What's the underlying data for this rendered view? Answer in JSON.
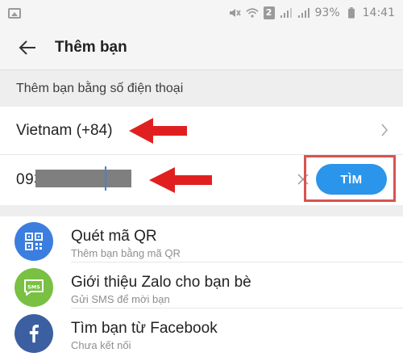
{
  "status_bar": {
    "battery_percent": "93%",
    "time": "14:41",
    "sim_label": "2"
  },
  "header": {
    "title": "Thêm bạn"
  },
  "section": {
    "label": "Thêm bạn bằng số điện thoại"
  },
  "country": {
    "value": "Vietnam (+84)"
  },
  "phone": {
    "value": "093"
  },
  "find_button": {
    "label": "TÌM"
  },
  "menu": {
    "items": [
      {
        "title": "Quét mã QR",
        "subtitle": "Thêm bạn bằng mã QR",
        "icon": "qr-code-icon",
        "color": "#3b7ee0"
      },
      {
        "title": "Giới thiệu Zalo cho bạn bè",
        "subtitle": "Gửi SMS để mời bạn",
        "icon": "sms-icon",
        "color": "#79c043"
      },
      {
        "title": "Tìm bạn từ Facebook",
        "subtitle": "Chưa kết nối",
        "icon": "facebook-icon",
        "color": "#3b5fa0"
      }
    ]
  },
  "colors": {
    "accent": "#2a95ea",
    "annotation_red": "#e02020"
  }
}
